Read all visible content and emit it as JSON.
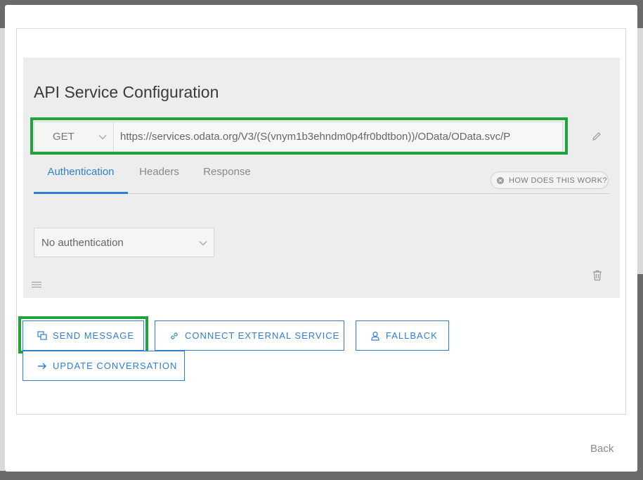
{
  "panel": {
    "title": "API Service Configuration",
    "method": "GET",
    "url": "https://services.odata.org/V3/(S(vnym1b3ehndm0p4fr0bdtbon))/OData/OData.svc/P"
  },
  "tabs": [
    {
      "label": "Authentication",
      "active": true
    },
    {
      "label": "Headers",
      "active": false
    },
    {
      "label": "Response",
      "active": false
    }
  ],
  "help": {
    "label": "HOW DOES THIS WORK?"
  },
  "auth": {
    "selected": "No authentication"
  },
  "actions": {
    "send_message": "SEND MESSAGE",
    "connect_external": "CONNECT EXTERNAL SERVICE",
    "fallback": "FALLBACK",
    "update_conversation": "UPDATE CONVERSATION"
  },
  "footer": {
    "back": "Back"
  },
  "colors": {
    "accent": "#2f7fd0",
    "highlight": "#1fa33a"
  },
  "icons": [
    "chevron-down-icon",
    "pencil-icon",
    "help-circle-icon",
    "trash-icon",
    "drag-handle-icon",
    "message-icon",
    "link-icon",
    "user-icon",
    "arrow-right-icon"
  ]
}
